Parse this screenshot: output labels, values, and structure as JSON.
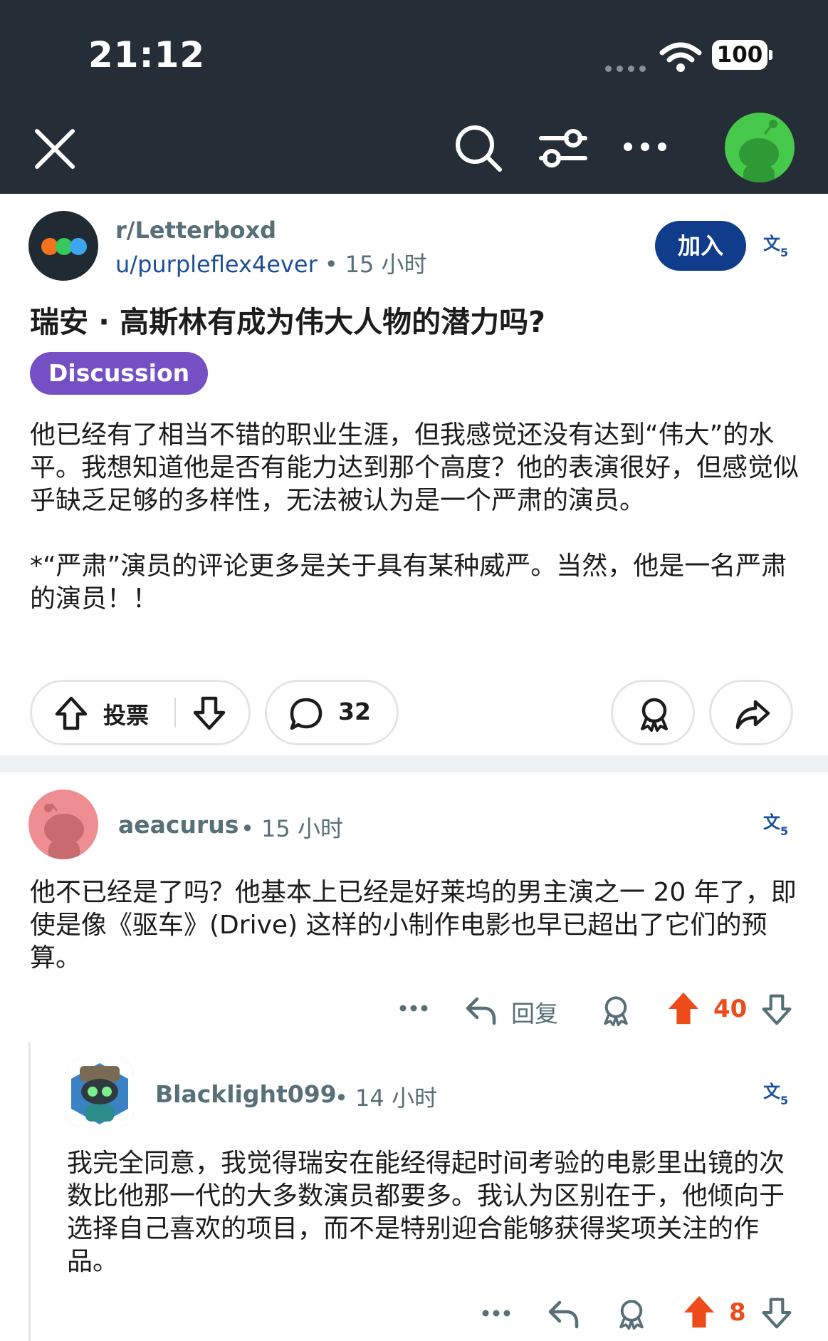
{
  "status_bar": {
    "time": "21:12",
    "battery": "100"
  },
  "colors": {
    "header_bg": "#252d36",
    "accent_blue": "#0f3d8c",
    "flair_purple": "#7450c4",
    "upvote_orange": "#ee4b1a"
  },
  "toolbar": {
    "icons": [
      "close-icon",
      "search-icon",
      "filter-icon",
      "more-icon",
      "avatar"
    ]
  },
  "post": {
    "subreddit": "r/Letterboxd",
    "author": "u/purpleflex4ever",
    "separator": "•",
    "time": "15 小时",
    "join_label": "加入",
    "title": "瑞安 · 高斯林有成为伟大人物的潜力吗?",
    "flair": "Discussion",
    "body": [
      "他已经有了相当不错的职业生涯，但我感觉还没有达到“伟大”的水平。我想知道他是否有能力达到那个高度？他的表演很好，但感觉似乎缺乏足够的多样性，无法被认为是一个严肃的演员。",
      "*“严肃”演员的评论更多是关于具有某种威严。当然，他是一名严肃的演员！！"
    ],
    "vote_label": "投票",
    "comment_count": "32"
  },
  "comments": [
    {
      "author": "aeacurus",
      "separator": "•",
      "time": "15 小时",
      "body": "他不已经是了吗？他基本上已经是好莱坞的男主演之一 20 年了，即使是像《驱车》(Drive) 这样的小制作电影也早已超出了它们的预算。",
      "reply_label": "回复",
      "score": "40"
    },
    {
      "author": "Blacklight099",
      "separator": "•",
      "time": "14 小时",
      "body": "我完全同意，我觉得瑞安在能经得起时间考验的电影里出镜的次数比他那一代的大多数演员都要多。我认为区别在于，他倾向于选择自己喜欢的项目，而不是特别迎合能够获得奖项关注的作品。",
      "score": "8"
    }
  ]
}
